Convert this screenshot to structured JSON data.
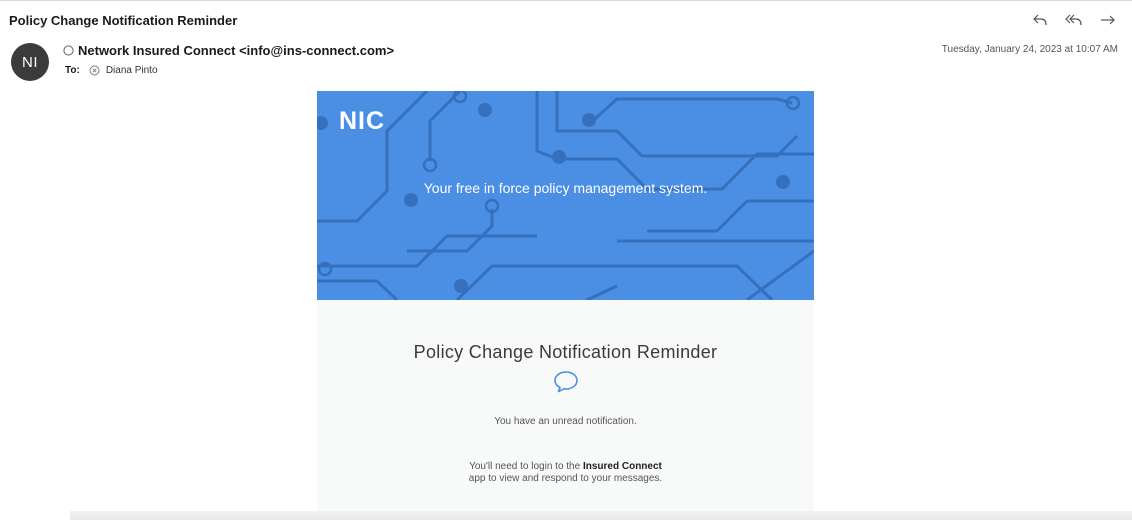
{
  "header": {
    "subject": "Policy Change Notification Reminder",
    "sender": "Network Insured Connect <info@ins-connect.com>",
    "avatar_initials": "NI",
    "to_label": "To:",
    "recipient": "Diana Pinto",
    "date": "Tuesday, January 24, 2023 at 10:07 AM",
    "actions": [
      "reply-icon",
      "reply-all-icon",
      "forward-icon"
    ]
  },
  "email": {
    "logo_text": "NIC",
    "tagline": "Your free in force policy management system.",
    "title": "Policy Change Notification Reminder",
    "notice": "You have an unread notification.",
    "instructions_prefix": "You'll need to login to the",
    "app_name": "Insured Connect",
    "instructions_suffix": "app to view and respond to your messages."
  },
  "colors": {
    "banner_blue": "#4a8fe3",
    "circuit_line": "#3670bd",
    "card_background": "#f8f9f9",
    "avatar_background": "#3b3b3b"
  }
}
